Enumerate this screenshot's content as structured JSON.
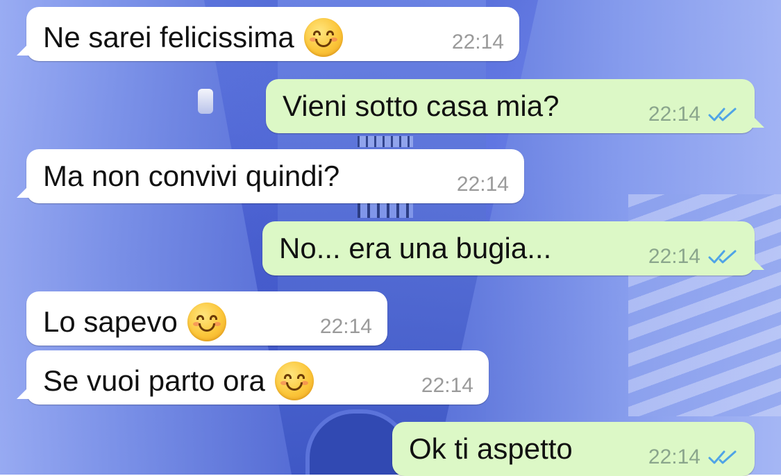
{
  "colors": {
    "incoming_bubble": "#ffffff",
    "outgoing_bubble": "#dcf8c6",
    "read_ticks": "#4fa4e6",
    "timestamp": "#9a9a9a"
  },
  "messages": [
    {
      "direction": "incoming",
      "text": "Ne sarei felicissima",
      "emoji": "smiling-face-icon",
      "time": "22:14"
    },
    {
      "direction": "outgoing",
      "text": "Vieni sotto casa mia?",
      "time": "22:14",
      "status": "read"
    },
    {
      "direction": "incoming",
      "text": "Ma non convivi quindi?",
      "time": "22:14"
    },
    {
      "direction": "outgoing",
      "text": "No... era una bugia...",
      "time": "22:14",
      "status": "read"
    },
    {
      "direction": "incoming",
      "text": "Lo sapevo",
      "emoji": "smiling-face-icon",
      "time": "22:14"
    },
    {
      "direction": "incoming",
      "text": "Se vuoi parto ora",
      "emoji": "smiling-face-icon",
      "time": "22:14"
    },
    {
      "direction": "outgoing",
      "text": "Ok ti aspetto",
      "time": "22:14",
      "status": "read"
    }
  ]
}
